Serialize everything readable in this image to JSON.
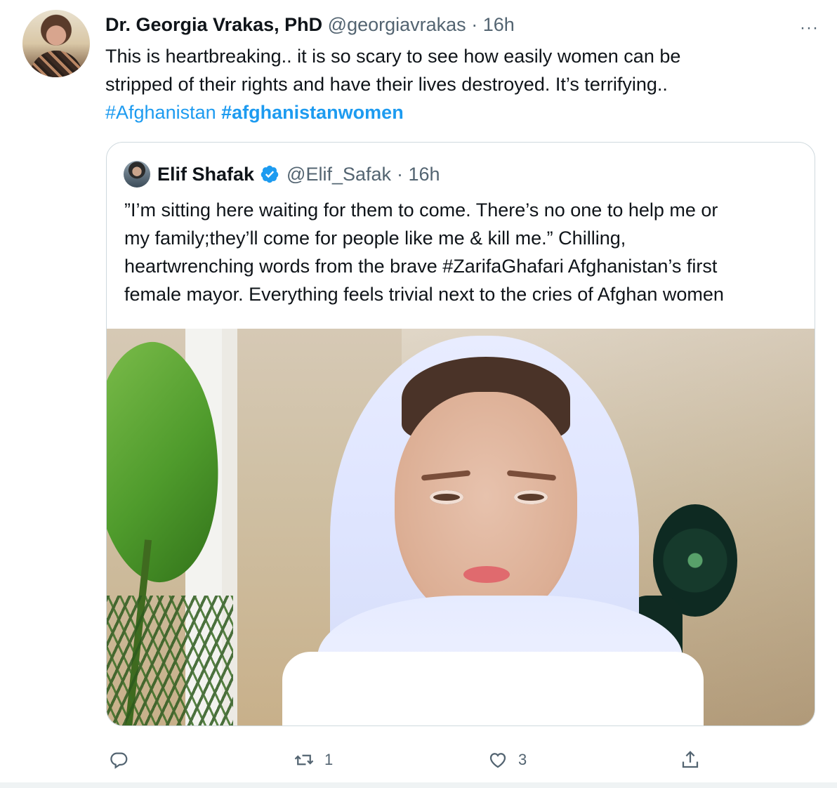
{
  "tweet": {
    "author_name": "Dr. Georgia Vrakas, PhD",
    "author_handle": "@georgiavrakas",
    "time": "· 16h",
    "more": "···",
    "text_line1": "This is heartbreaking.. it is so scary to see how easily women can be",
    "text_line2": "stripped of their rights and have their lives destroyed. It’s terrifying..",
    "hashtag1": "#Afghanistan",
    "hashtag2": "#afghanistanwomen"
  },
  "quoted": {
    "author_name": "Elif Shafak",
    "author_handle": "@Elif_Safak",
    "time": "· 16h",
    "text_line1": "”I’m sitting here waiting for them to come. There’s no one to help me or",
    "text_line2": "my family;they’ll come for people like me & kill me.” Chilling,",
    "text_line3": "heartwrenching words from the brave #ZarifaGhafari Afghanistan’s first",
    "text_line4": "female mayor. Everything feels trivial next to the cries of Afghan women"
  },
  "actions": {
    "reply_count": "",
    "retweet_count": "1",
    "like_count": "3"
  },
  "icons": {
    "reply": "reply-icon",
    "retweet": "retweet-icon",
    "like": "heart-icon",
    "share": "share-icon",
    "verified": "verified-badge-icon"
  },
  "colors": {
    "link": "#1d9bf0",
    "secondary_text": "#536471",
    "border": "#cfd9de"
  }
}
